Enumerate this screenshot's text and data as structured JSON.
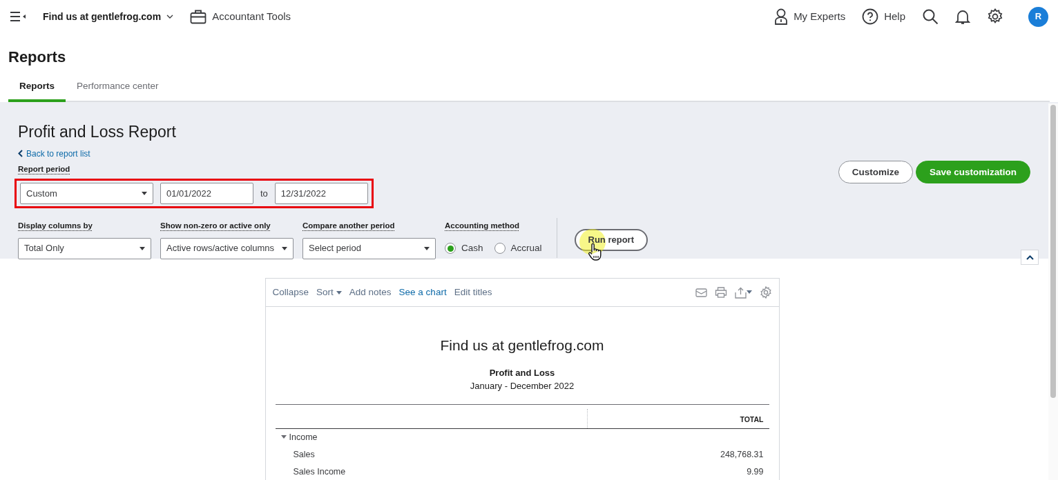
{
  "nav": {
    "company": "Find us at gentlefrog.com",
    "accountant_tools": "Accountant Tools",
    "my_experts": "My Experts",
    "help": "Help",
    "avatar": "R"
  },
  "page_title": "Reports",
  "tabs": [
    {
      "label": "Reports",
      "selected": true
    },
    {
      "label": "Performance center",
      "selected": false
    }
  ],
  "report_header": {
    "title": "Profit and Loss Report",
    "back_link": "Back to report list",
    "customize": "Customize",
    "save": "Save customization"
  },
  "report_period": {
    "label": "Report period",
    "preset": "Custom",
    "from": "01/01/2022",
    "to_label": "to",
    "to": "12/31/2022",
    "highlighted": true
  },
  "filters": [
    {
      "label": "Display columns by",
      "value": "Total Only"
    },
    {
      "label": "Show non-zero or active only",
      "value": "Active rows/active columns"
    },
    {
      "label": "Compare another period",
      "value": "Select period"
    }
  ],
  "accounting_method": {
    "label": "Accounting method",
    "options": [
      {
        "label": "Cash",
        "selected": true
      },
      {
        "label": "Accrual",
        "selected": false
      }
    ]
  },
  "run_report": "Run report",
  "toolbar": [
    {
      "label": "Collapse",
      "dropdown": false,
      "emphasis": false
    },
    {
      "label": "Sort",
      "dropdown": true,
      "emphasis": false
    },
    {
      "label": "Add notes",
      "dropdown": false,
      "emphasis": false
    },
    {
      "label": "See a chart",
      "dropdown": false,
      "emphasis": true
    },
    {
      "label": "Edit titles",
      "dropdown": false,
      "emphasis": false
    }
  ],
  "report": {
    "company": "Find us at gentlefrog.com",
    "title": "Profit and Loss",
    "period": "January - December 2022",
    "total_column": "TOTAL",
    "rows": [
      {
        "label": "Income",
        "expanded": true,
        "children": [
          {
            "label": "Sales",
            "amount": "248,768.31"
          },
          {
            "label": "Sales Income",
            "amount": "9.99"
          }
        ]
      }
    ]
  }
}
